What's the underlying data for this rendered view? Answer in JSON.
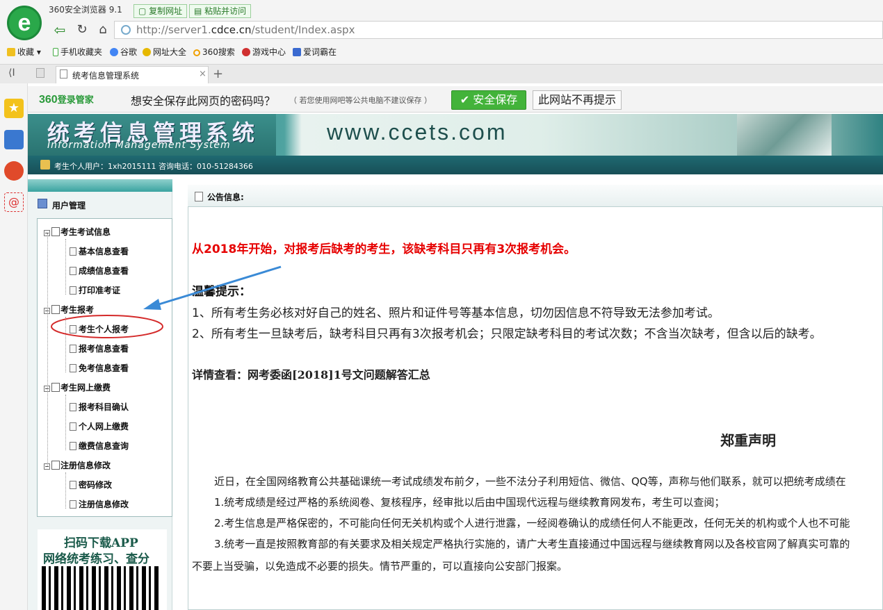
{
  "browser": {
    "name": "360安全浏览器 9.1",
    "copy_url": "复制网址",
    "paste_visit": "粘贴并访问",
    "url_prefix": "http://server1.",
    "url_domain": "cdce.cn",
    "url_path": "/student/Index.aspx",
    "bookmarks": [
      "收藏",
      "手机收藏夹",
      "谷歌",
      "网址大全",
      "360搜索",
      "游戏中心",
      "爱词霸在"
    ],
    "tab_title": "统考信息管理系统",
    "tab_close": "×",
    "tab_new": "+"
  },
  "password_bar": {
    "brand": "360",
    "brand_sub": "登录管家",
    "question": "想安全保存此网页的密码吗？",
    "note": "（ 若您使用网吧等公共电脑不建议保存 ）",
    "save": "安全保存",
    "never": "此网站不再提示"
  },
  "site": {
    "title": "统考信息管理系统",
    "subtitle": "Information  Management  System",
    "url": "www.ccets.com",
    "user_info": "考生个人用户：1xh2015111 咨询电话：010-51284366"
  },
  "nav": {
    "header": "用户管理",
    "groups": [
      {
        "label": "考生考试信息",
        "items": [
          "基本信息查看",
          "成绩信息查看",
          "打印准考证"
        ]
      },
      {
        "label": "考生报考",
        "items": [
          "考生个人报考",
          "报考信息查看",
          "免考信息查看"
        ]
      },
      {
        "label": "考生网上缴费",
        "items": [
          "报考科目确认",
          "个人网上缴费",
          "缴费信息查询"
        ]
      },
      {
        "label": "注册信息修改",
        "items": [
          "密码修改",
          "注册信息修改"
        ]
      }
    ],
    "qr_line1": "扫码下载APP",
    "qr_line2": "网络统考练习、查分"
  },
  "main": {
    "header": "公告信息:",
    "notice": "从2018年开始，对报考后缺考的考生，该缺考科目只再有3次报考机会。",
    "tips_title": "温馨提示：",
    "tip1": "1、所有考生务必核对好自己的姓名、照片和证件号等基本信息，切勿因信息不符导致无法参加考试。",
    "tip2": "2、所有考生一旦缺考后，缺考科目只再有3次报考机会；只限定缺考科目的考试次数；不含当次缺考，但含以后的缺考。",
    "detail": "详情查看：网考委函[2018]1号文问题解答汇总",
    "declaration_title": "郑重声明",
    "paragraphs": [
      "近日，在全国网络教育公共基础课统一考试成绩发布前夕，一些不法分子利用短信、微信、QQ等，声称与他们联系，就可以把统考成绩在",
      "1.统考成绩是经过严格的系统阅卷、复核程序，经审批以后由中国现代远程与继续教育网发布，考生可以查阅；",
      "2.考生信息是严格保密的，不可能向任何无关机构或个人进行泄露，一经阅卷确认的成绩任何人不能更改，任何无关的机构或个人也不可能",
      "3.统考一直是按照教育部的有关要求及相关规定严格执行实施的，请广大考生直接通过中国远程与继续教育网以及各校官网了解真实可靠的",
      "不要上当受骗，以免造成不必要的损失。情节严重的，可以直接向公安部门报案。"
    ]
  },
  "colors": {
    "notice_red": "#e60000",
    "teal": "#1f6a72",
    "annotation_blue": "#3a8ad6",
    "annotation_red": "#d42a2a"
  }
}
